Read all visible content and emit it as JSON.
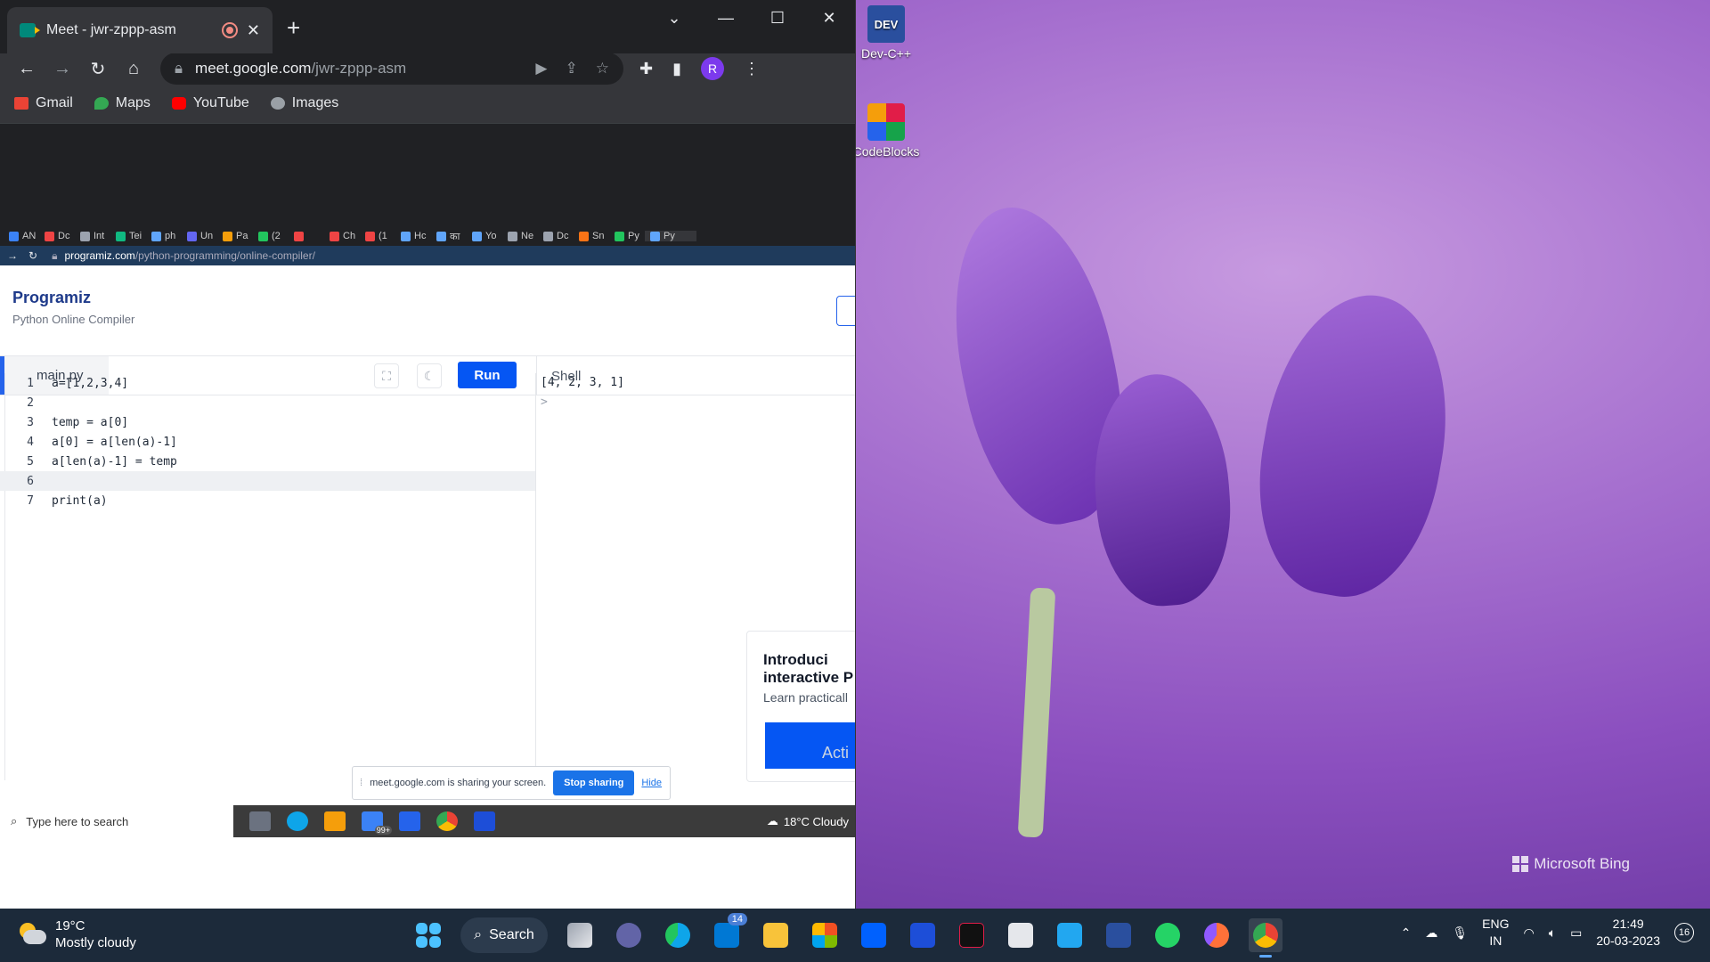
{
  "browser": {
    "tab_title": "Meet - jwr-zppp-asm",
    "url_host": "meet.google.com",
    "url_path": "/jwr-zppp-asm",
    "avatar_letter": "R",
    "bookmarks": [
      "Gmail",
      "Maps",
      "YouTube",
      "Images"
    ]
  },
  "desktop": {
    "icons": [
      "Dev-C++",
      "CodeBlocks"
    ],
    "bing_label": "Microsoft Bing"
  },
  "shared": {
    "tabs": [
      "AN",
      "Dc",
      "Int",
      "Tei",
      "ph",
      "Un",
      "Pa",
      "(2",
      "",
      "Ch",
      "(1",
      "Hc",
      "का",
      "Yo",
      "Ne",
      "Dc",
      "Sn",
      "Py",
      "Py"
    ],
    "url_host": "programiz.com",
    "url_path": "/python-programming/online-compiler/",
    "logo": "Programiz",
    "subtitle": "Python Online Compiler",
    "file_tab": "main.py",
    "run_label": "Run",
    "shell_label": "Shell",
    "code_lines": [
      "a=[1,2,3,4]",
      "",
      "temp = a[0]",
      "a[0] = a[len(a)-1]",
      "a[len(a)-1] = temp",
      "",
      "print(a)"
    ],
    "shell_output": [
      "[4, 2, 3, 1]",
      ">"
    ],
    "promo_title": "Introduci interactive P",
    "promo_text": "Learn practicall",
    "promo_button": "Acti",
    "share_message": "meet.google.com is sharing your screen.",
    "stop_sharing": "Stop sharing",
    "hide": "Hide",
    "inner_search_placeholder": "Type here to search",
    "inner_weather": "18°C  Cloudy",
    "inner_badge": "99+"
  },
  "taskbar": {
    "weather_temp": "19°C",
    "weather_desc": "Mostly cloudy",
    "search_label": "Search",
    "mail_badge": "14",
    "lang_top": "ENG",
    "lang_bottom": "IN",
    "time": "21:49",
    "date": "20-03-2023",
    "notifications": "16"
  }
}
